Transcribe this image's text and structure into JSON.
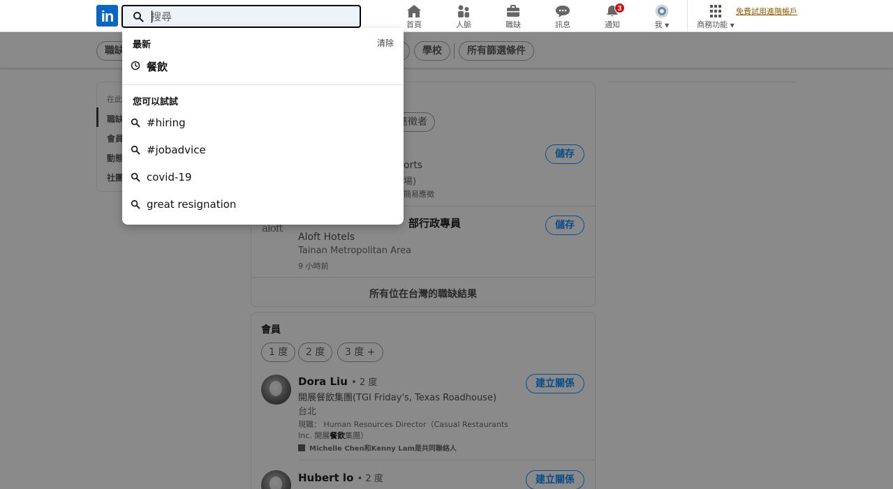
{
  "nav": {
    "logo_text": "in",
    "search": {
      "placeholder": "搜尋",
      "value": ""
    },
    "items": [
      {
        "label": "首頁",
        "icon": "home-icon"
      },
      {
        "label": "人脈",
        "icon": "network-icon"
      },
      {
        "label": "職缺",
        "icon": "jobs-icon"
      },
      {
        "label": "訊息",
        "icon": "messaging-icon"
      },
      {
        "label": "通知",
        "icon": "bell-icon",
        "badge": "3"
      },
      {
        "label": "我",
        "icon": "avatar"
      },
      {
        "label": "商務功能",
        "icon": "grid-icon"
      }
    ],
    "premium_link": "免費試用進階帳戶"
  },
  "filters": {
    "pills": [
      "職缺",
      "學校",
      "所有篩選條件"
    ]
  },
  "left_sidebar": {
    "heading": "在此",
    "items": [
      "職缺",
      "會員",
      "動態",
      "社團"
    ]
  },
  "jobs_section": {
    "pill_fragment": "應徵者",
    "job1": {
      "company_fragment": "orts",
      "location_fragment": "場)",
      "meta_fragment": "簡易應徵",
      "save_label": "儲存"
    },
    "job2": {
      "title": "Admin Assistant 餐飲部行政專員",
      "title_visible": "部行政專員",
      "company": "Aloft Hotels",
      "location": "Tainan Metropolitan Area",
      "time": "9 小時前",
      "save_label": "儲存",
      "logo_text": "aloft"
    },
    "see_all": "所有位在台灣的職缺結果"
  },
  "people_section": {
    "title": "會員",
    "degree_filters": [
      "1 度",
      "2 度",
      "3 度 +"
    ],
    "people": [
      {
        "name": "Dora Liu",
        "degree": "• 2 度",
        "headline": "開展餐飲集團(TGI Friday's, Texas Roadhouse)",
        "location": "台北",
        "current_line1": "現職： Human Resources Director（Casual Restaurants",
        "current_line2_pre": "Inc. 開展",
        "current_line2_bold": "餐飲",
        "current_line2_post": "集團）",
        "mutual": "Michelle Chen和Kenny Lam是共同聯絡人",
        "action": "建立關係"
      },
      {
        "name": "Hubert lo",
        "degree": "• 2 度",
        "action": "建立關係"
      }
    ]
  },
  "search_dropdown": {
    "recent_title": "最新",
    "clear_label": "清除",
    "recent": [
      "餐飲"
    ],
    "suggest_title": "您可以試試",
    "suggestions": [
      "#hiring",
      "#jobadvice",
      "covid-19",
      "great resignation"
    ]
  },
  "colors": {
    "brand": "#0a66c2",
    "badge": "#cc1016",
    "premium": "#915907",
    "overlay": "#8a8a8a"
  }
}
